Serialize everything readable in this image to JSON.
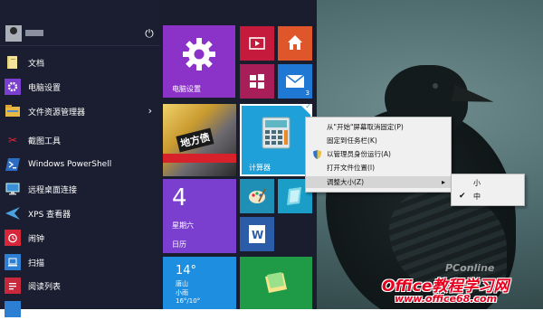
{
  "power_icon": "power-icon",
  "left_items": [
    {
      "label": "文档",
      "icon": "folder-icon"
    },
    {
      "label": "电脑设置",
      "icon": "gear-icon"
    },
    {
      "label": "文件资源管理器",
      "icon": "explorer-icon"
    },
    {
      "label": "截图工具",
      "icon": "scissors-icon"
    },
    {
      "label": "Windows PowerShell",
      "icon": "powershell-icon"
    },
    {
      "label": "远程桌面连接",
      "icon": "remote-desktop-icon"
    },
    {
      "label": "XPS 查看器",
      "icon": "xps-icon"
    },
    {
      "label": "闹钟",
      "icon": "alarm-icon"
    },
    {
      "label": "扫描",
      "icon": "scan-icon"
    },
    {
      "label": "阅读列表",
      "icon": "reading-list-icon"
    }
  ],
  "tiles": {
    "settings": {
      "label": "电脑设置",
      "color": "#8b33c9"
    },
    "calc": {
      "label": "计算器",
      "color": "#1fa0d8"
    },
    "calendar": {
      "day": "4",
      "weekday": "星期六",
      "label": "日历",
      "color": "#7b3fd0"
    },
    "weather": {
      "temp": "14°",
      "city": "唐山",
      "cond": "小雨",
      "range": "16°/10°"
    },
    "mail_count": "3",
    "news_banner": "地方债"
  },
  "context_menu": {
    "items": [
      "从\"开始\"屏幕取消固定(P)",
      "固定到任务栏(K)",
      "以管理员身份运行(A)",
      "打开文件位置(I)",
      "调整大小(Z)"
    ],
    "submenu": [
      "小",
      "中"
    ],
    "submenu_selected": "中"
  },
  "watermarks": {
    "pconline": "PConline",
    "office_site": "Office教程学习网",
    "office_url": "www.office68.com"
  }
}
